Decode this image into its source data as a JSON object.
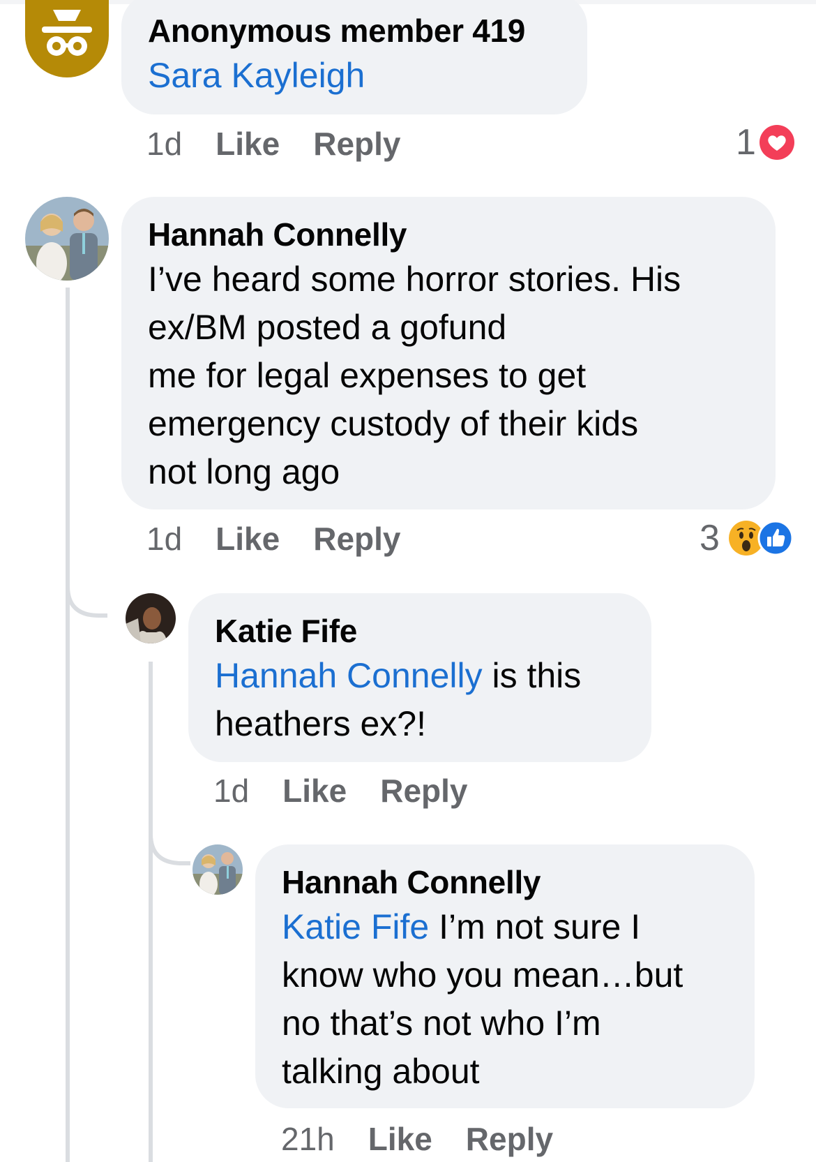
{
  "comments": [
    {
      "author": "Anonymous member 419",
      "mention": "Sara Kayleigh",
      "text": "",
      "time": "1d",
      "like": "Like",
      "reply": "Reply",
      "reaction_count": "1",
      "reaction_icons": [
        "heart-icon"
      ]
    },
    {
      "author": "Hannah Connelly",
      "mention": "",
      "text_lines": [
        "I’ve heard some horror stories. His",
        "ex/BM posted a gofund",
        "me for legal expenses to get",
        "emergency custody of their kids",
        "not long ago"
      ],
      "time": "1d",
      "like": "Like",
      "reply": "Reply",
      "reaction_count": "3",
      "reaction_icons": [
        "wow-icon",
        "like-icon"
      ]
    },
    {
      "author": "Katie Fife",
      "mention": "Hannah Connelly",
      "text_first": " is this",
      "text_rest": "heathers ex?!",
      "time": "1d",
      "like": "Like",
      "reply": "Reply"
    },
    {
      "author": "Hannah Connelly",
      "mention": "Katie Fife",
      "text_first": " I’m not sure I",
      "text_lines": [
        "know who you mean…but",
        "no that’s not who I’m",
        "talking about"
      ],
      "time": "21h",
      "like": "Like",
      "reply": "Reply"
    }
  ],
  "colors": {
    "bubble": "#f0f2f5",
    "mention": "#1b6fd1",
    "meta": "#65676b",
    "heart": "#f33e58",
    "like": "#1b74e4",
    "wow": "#f7b125",
    "anon_avatar": "#b58a07"
  }
}
